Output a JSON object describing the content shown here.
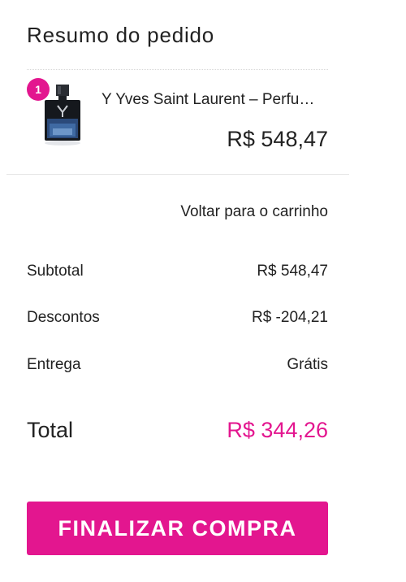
{
  "summary": {
    "title": "Resumo do pedido"
  },
  "product": {
    "quantity": "1",
    "name": "Y Yves Saint Laurent – Perfume Masculino – Eau de Parfum",
    "price": "R$ 548,47",
    "image_icon": "perfume-bottle-icon"
  },
  "links": {
    "back_to_cart": "Voltar para o carrinho"
  },
  "totals": {
    "subtotal_label": "Subtotal",
    "subtotal_value": "R$ 548,47",
    "discount_label": "Descontos",
    "discount_value": "R$ -204,21",
    "shipping_label": "Entrega",
    "shipping_value": "Grátis",
    "total_label": "Total",
    "total_value": "R$ 344,26"
  },
  "actions": {
    "checkout_label": "FINALIZAR COMPRA"
  },
  "colors": {
    "accent": "#e3168f",
    "text": "#222222",
    "divider": "#e6e6e6"
  }
}
